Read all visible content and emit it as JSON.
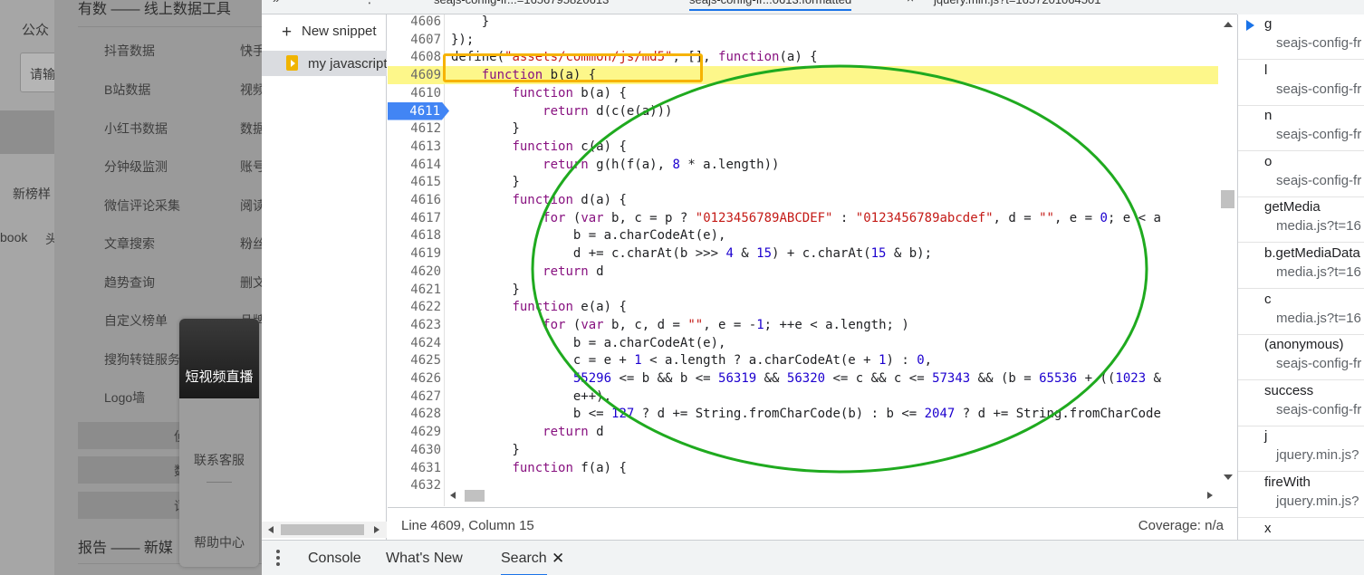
{
  "page": {
    "left_texts": [
      "公众",
      "请输",
      "新榜样",
      "book",
      "头"
    ],
    "menu_title": "有数 —— 线上数据工具",
    "menu_items": [
      "抖音数据",
      "B站数据",
      "小红书数据",
      "分钟级监测",
      "微信评论采集",
      "文章搜索",
      "趋势查询",
      "自定义榜单",
      "搜狗转链服务",
      "Logo墙"
    ],
    "menu_items_right": [
      "快手",
      "视频",
      "数据",
      "账号",
      "阅读",
      "粉丝",
      "删文",
      "品牌",
      ""
    ],
    "grey_box_chars": [
      "侦",
      "数",
      "词"
    ],
    "bottom_title": "报告 —— 新媒",
    "float": {
      "video_live": "短视频直播",
      "service": "联系客服",
      "help": "帮助中心"
    }
  },
  "devtools": {
    "tabs": [
      "seajs-config-fr...=1656795820613",
      "seajs-config-fr...0613.formatted",
      "jquery.min.js?t=1657201064501"
    ],
    "navigator": {
      "new_snippet": "New snippet",
      "snippet_name": "my javascript"
    },
    "editor": {
      "lines": [
        {
          "n": "4606",
          "text": "    }"
        },
        {
          "n": "4607",
          "text": "});"
        },
        {
          "n": "4608",
          "text": "define(\"assets/common/js/md5\", [], function(a) {"
        },
        {
          "n": "4609",
          "text": "    function b(a) {"
        },
        {
          "n": "4610",
          "text": "        function b(a) {"
        },
        {
          "n": "4611",
          "text": "            return d(c(e(a)))"
        },
        {
          "n": "4612",
          "text": "        }"
        },
        {
          "n": "4613",
          "text": "        function c(a) {"
        },
        {
          "n": "4614",
          "text": "            return g(h(f(a), 8 * a.length))"
        },
        {
          "n": "4615",
          "text": "        }"
        },
        {
          "n": "4616",
          "text": "        function d(a) {"
        },
        {
          "n": "4617",
          "text": "            for (var b, c = p ? \"0123456789ABCDEF\" : \"0123456789abcdef\", d = \"\", e = 0; e < a"
        },
        {
          "n": "4618",
          "text": "                b = a.charCodeAt(e),"
        },
        {
          "n": "4619",
          "text": "                d += c.charAt(b >>> 4 & 15) + c.charAt(15 & b);"
        },
        {
          "n": "4620",
          "text": "            return d"
        },
        {
          "n": "4621",
          "text": "        }"
        },
        {
          "n": "4622",
          "text": "        function e(a) {"
        },
        {
          "n": "4623",
          "text": "            for (var b, c, d = \"\", e = -1; ++e < a.length; )"
        },
        {
          "n": "4624",
          "text": "                b = a.charCodeAt(e),"
        },
        {
          "n": "4625",
          "text": "                c = e + 1 < a.length ? a.charCodeAt(e + 1) : 0,"
        },
        {
          "n": "4626",
          "text": "                55296 <= b && b <= 56319 && 56320 <= c && c <= 57343 && (b = 65536 + ((1023 &"
        },
        {
          "n": "4627",
          "text": "                e++),"
        },
        {
          "n": "4628",
          "text": "                b <= 127 ? d += String.fromCharCode(b) : b <= 2047 ? d += String.fromCharCode"
        },
        {
          "n": "4629",
          "text": "            return d"
        },
        {
          "n": "4630",
          "text": "        }"
        },
        {
          "n": "4631",
          "text": "        function f(a) {"
        },
        {
          "n": "4632",
          "text": ""
        }
      ],
      "highlight_line": "4609",
      "breakpoint_line": "4611"
    },
    "status": {
      "position": "Line 4609, Column 15",
      "coverage": "Coverage: n/a"
    },
    "drawer_tabs": [
      "Console",
      "What's New",
      "Search"
    ],
    "call_stack": [
      {
        "fn": "g",
        "src": "seajs-config-fr"
      },
      {
        "fn": "l",
        "src": "seajs-config-fr"
      },
      {
        "fn": "n",
        "src": "seajs-config-fr"
      },
      {
        "fn": "o",
        "src": "seajs-config-fr"
      },
      {
        "fn": "getMedia",
        "src": "media.js?t=16"
      },
      {
        "fn": "b.getMediaData",
        "src": "media.js?t=16"
      },
      {
        "fn": "c",
        "src": "media.js?t=16"
      },
      {
        "fn": "(anonymous)",
        "src": "seajs-config-fr"
      },
      {
        "fn": "success",
        "src": "seajs-config-fr"
      },
      {
        "fn": "j",
        "src": "jquery.min.js?"
      },
      {
        "fn": "fireWith",
        "src": "jquery.min.js?"
      },
      {
        "fn": "x",
        "src": ""
      }
    ]
  },
  "colors": {
    "highlight": "#fdf78a",
    "breakpoint": "#4285f4",
    "annotation_box": "#f6b300",
    "annotation_ellipse": "#1faa1f"
  }
}
